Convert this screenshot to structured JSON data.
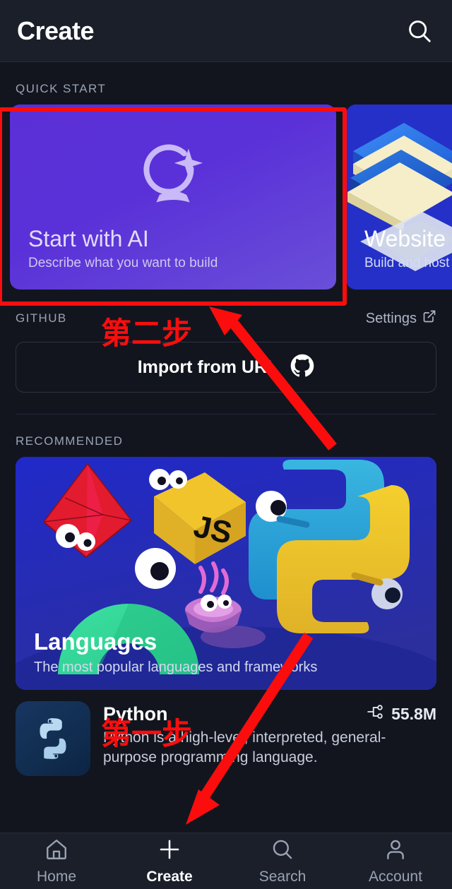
{
  "header": {
    "title": "Create",
    "search_icon": "search-icon"
  },
  "sections": {
    "quick_start_label": "QUICK START",
    "github_label": "GITHUB",
    "recommended_label": "RECOMMENDED",
    "settings_label": "Settings",
    "settings_icon": "external-link-icon"
  },
  "quick_start": {
    "cards": [
      {
        "title": "Start with AI",
        "subtitle": "Describe what you want to build",
        "icon": "ai-sparkle-crystal-ball-icon",
        "accent": "#5b2fd6"
      },
      {
        "title": "Website",
        "subtitle": "Build and host",
        "icon": "website-illustration",
        "accent": "#2030c8"
      }
    ]
  },
  "github": {
    "import_label": "Import from URL",
    "import_icon": "github-icon"
  },
  "recommended": {
    "card": {
      "title": "Languages",
      "subtitle": "The most popular languages and frameworks",
      "illustration": "languages-mascots-illustration"
    },
    "items": [
      {
        "name": "Python",
        "description": "Python is a high-level, interpreted, general-purpose programming language.",
        "stat_value": "55.8M",
        "stat_icon": "fork-network-icon",
        "icon": "python-logo-icon"
      }
    ]
  },
  "tabbar": {
    "items": [
      {
        "label": "Home",
        "icon": "home-icon",
        "active": false
      },
      {
        "label": "Create",
        "icon": "plus-icon",
        "active": true
      },
      {
        "label": "Search",
        "icon": "search-icon",
        "active": false
      },
      {
        "label": "Account",
        "icon": "person-icon",
        "active": false
      }
    ]
  },
  "annotations": {
    "color": "#fb0d0d",
    "step_one": "第一步",
    "step_two": "第二步",
    "highlight_target": "start-with-ai-card"
  }
}
